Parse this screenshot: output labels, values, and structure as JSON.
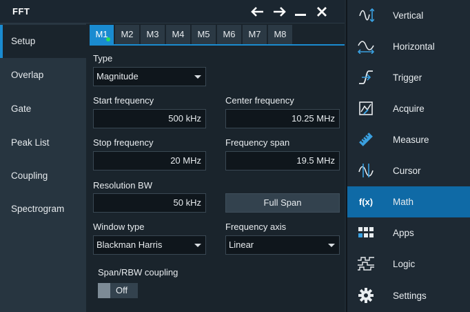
{
  "dialog": {
    "title": "FFT",
    "controls": [
      "back-arrow-icon",
      "forward-arrow-icon",
      "minimize-icon",
      "close-icon"
    ]
  },
  "sidetabs": [
    {
      "label": "Setup",
      "active": true
    },
    {
      "label": "Overlap"
    },
    {
      "label": "Gate"
    },
    {
      "label": "Peak List"
    },
    {
      "label": "Coupling"
    },
    {
      "label": "Spectrogram"
    }
  ],
  "math_tabs": [
    "M1",
    "M2",
    "M3",
    "M4",
    "M5",
    "M6",
    "M7",
    "M8"
  ],
  "active_math_tab": "M1",
  "setup": {
    "type_label": "Type",
    "type_value": "Magnitude",
    "start_frequency_label": "Start frequency",
    "start_frequency_value": "500 kHz",
    "center_frequency_label": "Center frequency",
    "center_frequency_value": "10.25 MHz",
    "stop_frequency_label": "Stop frequency",
    "stop_frequency_value": "20 MHz",
    "frequency_span_label": "Frequency span",
    "frequency_span_value": "19.5 MHz",
    "resolution_bw_label": "Resolution BW",
    "resolution_bw_value": "50 kHz",
    "full_span_label": "Full Span",
    "window_type_label": "Window type",
    "window_type_value": "Blackman Harris",
    "frequency_axis_label": "Frequency axis",
    "frequency_axis_value": "Linear",
    "span_rbw_coupling_label": "Span/RBW coupling",
    "span_rbw_coupling_value": "Off"
  },
  "right_menu": [
    {
      "label": "Vertical",
      "icon": "vertical-icon"
    },
    {
      "label": "Horizontal",
      "icon": "horizontal-icon"
    },
    {
      "label": "Trigger",
      "icon": "trigger-icon"
    },
    {
      "label": "Acquire",
      "icon": "acquire-icon"
    },
    {
      "label": "Measure",
      "icon": "measure-icon"
    },
    {
      "label": "Cursor",
      "icon": "cursor-icon"
    },
    {
      "label": "Math",
      "icon": "math-icon",
      "active": true,
      "icon_text": "f(x)"
    },
    {
      "label": "Apps",
      "icon": "apps-icon"
    },
    {
      "label": "Logic",
      "icon": "logic-icon"
    },
    {
      "label": "Settings",
      "icon": "settings-icon"
    }
  ],
  "colors": {
    "accent": "#1a8bd0",
    "active_menu": "#0f6aa6",
    "indicator_dot": "#28e05a"
  }
}
